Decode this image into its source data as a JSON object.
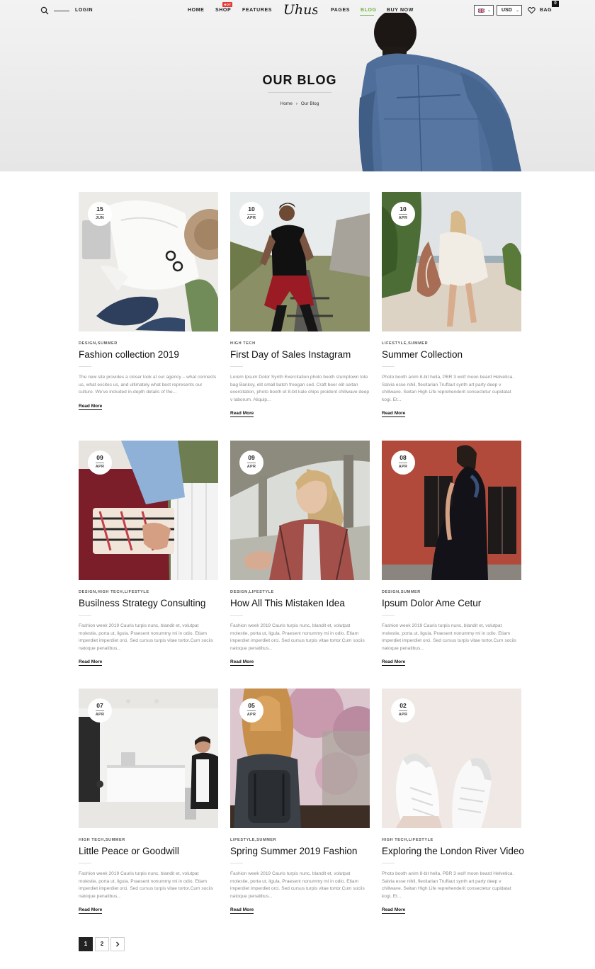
{
  "header": {
    "login": "LOGIN",
    "nav": [
      {
        "label": "HOME"
      },
      {
        "label": "SHOP",
        "badge": "HOT"
      },
      {
        "label": "FEATURES"
      },
      {
        "label": "PAGES"
      },
      {
        "label": "BLOG",
        "active": true
      },
      {
        "label": "BUY NOW"
      }
    ],
    "logo_text": "Uhus",
    "currency": "USD",
    "bag_label": "BAG",
    "bag_count": "0"
  },
  "hero": {
    "title": "OUR BLOG",
    "breadcrumb": {
      "home": "Home",
      "separator": "›",
      "current": "Our Blog"
    }
  },
  "posts": [
    {
      "day": "15",
      "month": "JUN",
      "categories": "DESIGN,SUMMER",
      "title": "Fashion collection 2019",
      "excerpt": "The new site provides a closer look at our agency – what connects us, what excites us, and ultimately what best represents our culture. We've included in-depth details of the...",
      "read_more": "Read More"
    },
    {
      "day": "10",
      "month": "APR",
      "categories": "HIGH TECH",
      "title": "First Day of Sales Instagram",
      "excerpt": "Lorem Ipsum Dolor Synth Exercitation photo booth stumptown tote bag Banksy, elit small batch freegan sed. Craft beer elit seitan exercitation, photo booth et 8-bit kale chips proident chillwave deep v laborum. Aliquip...",
      "read_more": "Read More"
    },
    {
      "day": "10",
      "month": "APR",
      "categories": "LIFESTYLE,SUMMER",
      "title": "Summer Collection",
      "excerpt": "Photo booth anim 8-bit hella, PBR 3 wolf moon beard Helvetica. Salvia esse nihil, flexitarian Truffaut synth art party deep v chillwave. Seitan High Life reprehenderit consectetur cupidatat kogi. Et...",
      "read_more": "Read More"
    },
    {
      "day": "09",
      "month": "APR",
      "categories": "DESIGN,HIGH TECH,LIFESTYLE",
      "title": "Busilness Strategy Consulting",
      "excerpt": "Fashion week 2019 Cauris turpis nunc, blandit et, volutpat molestie, porta ut, ligula. Praesent nonummy mi in odio. Etiam imperdiet imperdiet orci. Sed cursus turpis vitae tortor.Cum sociis natoque penatibus...",
      "read_more": "Read More"
    },
    {
      "day": "09",
      "month": "APR",
      "categories": "DESIGN,LIFESTYLE",
      "title": "How All This Mistaken Idea",
      "excerpt": "Fashion week 2019 Cauris turpis nunc, blandit et, volutpat molestie, porta ut, ligula. Praesent nonummy mi in odio. Etiam imperdiet imperdiet orci. Sed cursus turpis vitae tortor.Cum sociis natoque penatibus...",
      "read_more": "Read More"
    },
    {
      "day": "08",
      "month": "APR",
      "categories": "DESIGN,SUMMER",
      "title": "Ipsum Dolor Ame Cetur",
      "excerpt": "Fashion week 2019 Cauris turpis nunc, blandit et, volutpat molestie, porta ut, ligula. Praesent nonummy mi in odio. Etiam imperdiet imperdiet orci. Sed cursus turpis vitae tortor.Cum sociis natoque penatibus...",
      "read_more": "Read More"
    },
    {
      "day": "07",
      "month": "APR",
      "categories": "HIGH TECH,SUMMER",
      "title": "Little Peace or Goodwill",
      "excerpt": "Fashion week 2019 Cauris turpis nunc, blandit et, volutpat molestie, porta ut, ligula. Praesent nonummy mi in odio. Etiam imperdiet imperdiet orci. Sed cursus turpis vitae tortor.Cum sociis natoque penatibus...",
      "read_more": "Read More"
    },
    {
      "day": "05",
      "month": "APR",
      "categories": "LIFESTYLE,SUMMER",
      "title": "Spring Summer 2019 Fashion",
      "excerpt": "Fashion week 2019 Cauris turpis nunc, blandit et, volutpat molestie, porta ut, ligula. Praesent nonummy mi in odio. Etiam imperdiet imperdiet orci. Sed cursus turpis vitae tortor.Cum sociis natoque penatibus...",
      "read_more": "Read More"
    },
    {
      "day": "02",
      "month": "APR",
      "categories": "HIGH TECH,LIFESTYLE",
      "title": "Exploring the London River Video",
      "excerpt": "Photo booth anim 8-bit hella, PBR 3 wolf moon beard Helvetica. Salvia esse nihil, flexitarian Truffaut synth art party deep v chillwave. Seitan High Life reprehenderit consectetur cupidatat kogi. Et...",
      "read_more": "Read More"
    }
  ],
  "pagination": {
    "pages": [
      "1",
      "2"
    ],
    "current": "1",
    "next_icon": "chevron-right-icon"
  },
  "colors": {
    "accent": "#6cb33f",
    "hot": "#e53935"
  }
}
